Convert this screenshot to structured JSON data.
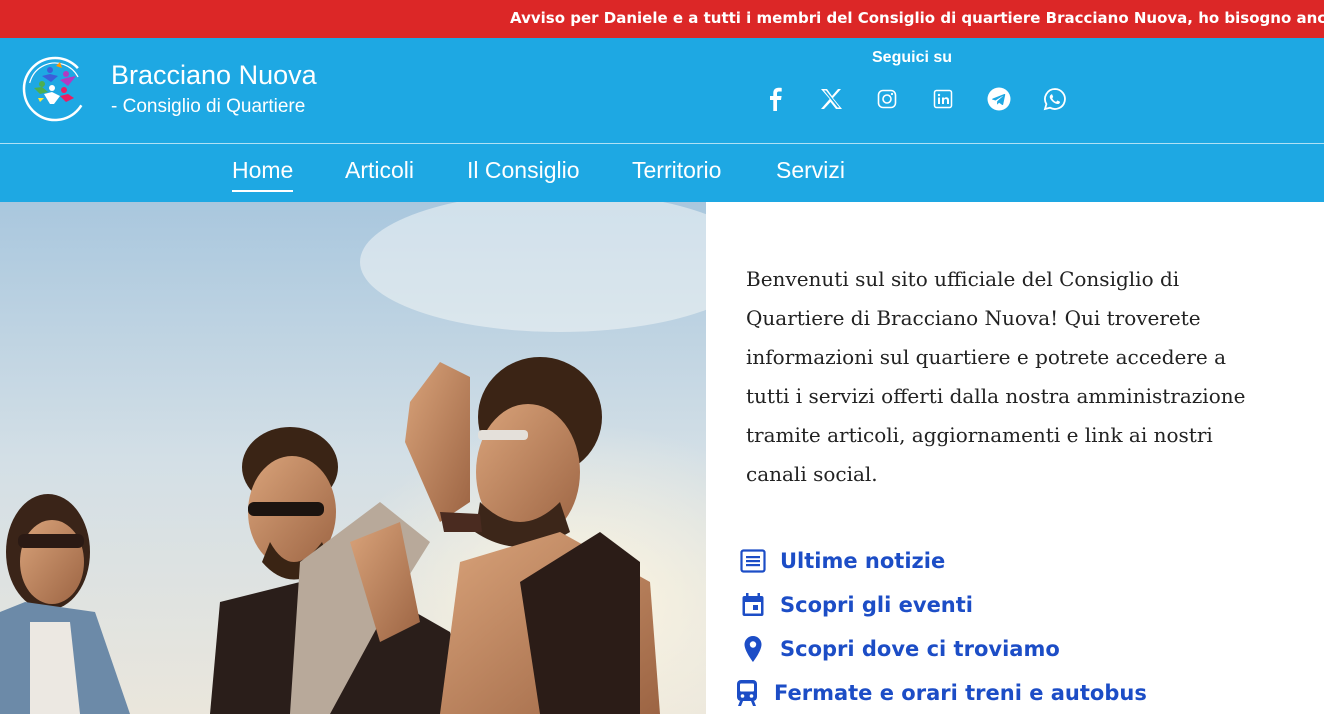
{
  "ticker": {
    "text": "Avviso per Daniele e a tutti i membri del Consiglio di quartiere Bracciano Nuova, ho bisogno anc"
  },
  "header": {
    "title": "Bracciano Nuova",
    "subtitle": "- Consiglio di Quartiere",
    "follow_label": "Seguici su",
    "social_icons": [
      "facebook-icon",
      "x-icon",
      "instagram-icon",
      "linkedin-icon",
      "telegram-icon",
      "whatsapp-icon"
    ],
    "bg_color": "#1ea8e3"
  },
  "nav": {
    "items": [
      {
        "label": "Home",
        "active": true
      },
      {
        "label": "Articoli"
      },
      {
        "label": "Il Consiglio"
      },
      {
        "label": "Territorio"
      },
      {
        "label": "Servizi"
      }
    ]
  },
  "intro": {
    "lines": [
      "Benvenuti sul sito ufficiale del Consiglio di",
      "Quartiere di Bracciano Nuova! Qui troverete",
      "informazioni sul quartiere e potrete accedere a",
      "tutti i servizi offerti dalla nostra amministrazione",
      "tramite articoli, aggiornamenti e link ai nostri",
      "canali social."
    ]
  },
  "quick_links": [
    {
      "label": "Ultime notizie",
      "icon": "newspaper-icon"
    },
    {
      "label": "Scopri gli eventi",
      "icon": "calendar-icon"
    },
    {
      "label": "Scopri dove ci troviamo",
      "icon": "map-pin-icon"
    },
    {
      "label": "Fermate e orari treni e autobus",
      "icon": "train-icon"
    }
  ],
  "colors": {
    "ticker_bg": "#dc2727",
    "header_bg": "#1ea8e3",
    "link": "#1c4dc6"
  }
}
